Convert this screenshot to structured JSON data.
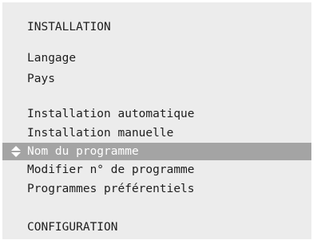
{
  "menu": {
    "section_installation": "INSTALLATION",
    "items_group1": [
      {
        "label": "Langage"
      },
      {
        "label": "Pays"
      }
    ],
    "items_group2": [
      {
        "label": "Installation automatique"
      },
      {
        "label": "Installation manuelle"
      },
      {
        "label": "Nom du programme",
        "selected": true
      },
      {
        "label": "Modifier n° de programme"
      },
      {
        "label": "Programmes préférentiels"
      }
    ],
    "section_configuration": "CONFIGURATION",
    "selector_icon": "up-down-arrows-icon"
  },
  "colors": {
    "panel_background": "#ececec",
    "text": "#1e1e1e",
    "highlight_background": "#a4a4a4",
    "highlight_text": "#ffffff"
  }
}
